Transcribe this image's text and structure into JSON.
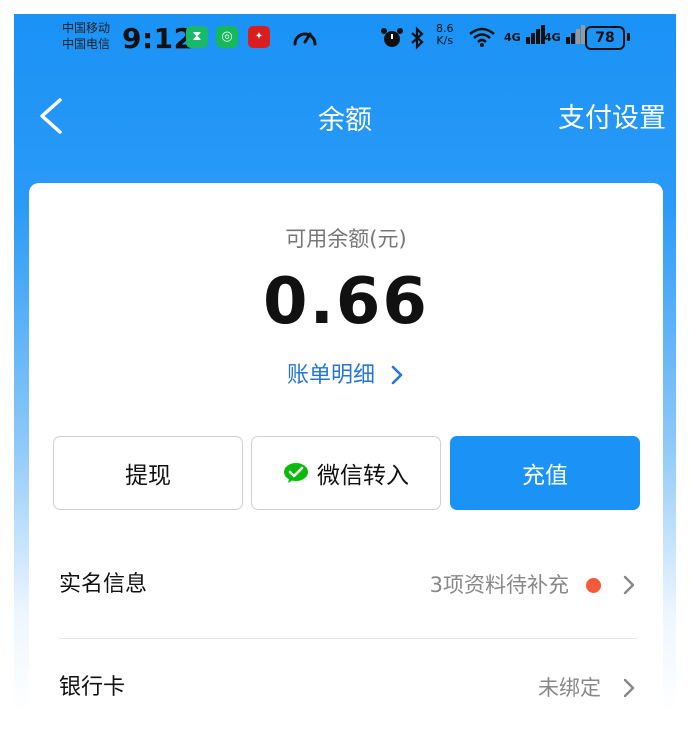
{
  "status_bar": {
    "carrier1": "中国移动",
    "carrier2": "中国电信",
    "time": "9:12",
    "net_speed_value": "8.6",
    "net_speed_unit": "K/s",
    "signal1": "4G",
    "signal2": "4G",
    "battery": "78"
  },
  "nav": {
    "title": "余额",
    "action": "支付设置"
  },
  "balance": {
    "label": "可用余额(元)",
    "value": "0.66",
    "bill_link": "账单明细"
  },
  "buttons": {
    "withdraw": "提现",
    "wechat_transfer": "微信转入",
    "recharge": "充值"
  },
  "rows": {
    "realname_label": "实名信息",
    "realname_value": "3项资料待补充",
    "bankcard_label": "银行卡",
    "bankcard_value": "未绑定"
  },
  "colors": {
    "primary": "#1a92f6",
    "link": "#2676d8",
    "alert_dot": "#f45b3a",
    "wechat_green": "#09bb07"
  }
}
